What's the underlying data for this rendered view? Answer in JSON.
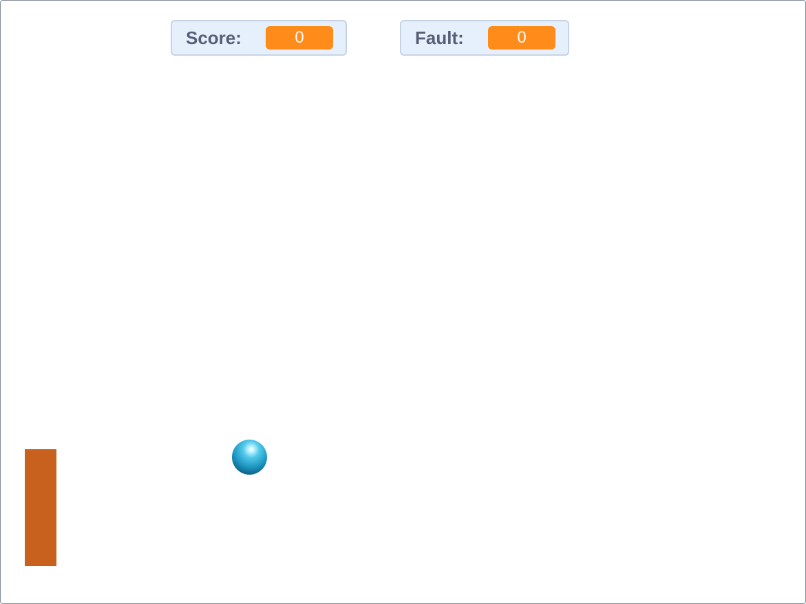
{
  "monitors": {
    "score": {
      "label": "Score:",
      "value": "0"
    },
    "fault": {
      "label": "Fault:",
      "value": "0"
    }
  },
  "colors": {
    "monitor_value_bg": "#ff8c1a",
    "monitor_bg": "#e6f0fd",
    "monitor_label": "#575e75",
    "paddle": "#c8601e",
    "ball": "#1e98c2"
  }
}
